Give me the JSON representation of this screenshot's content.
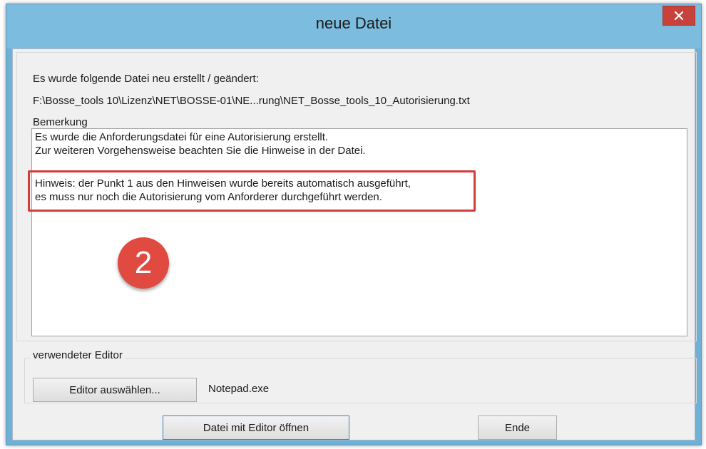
{
  "window": {
    "title": "neue Datei"
  },
  "info": {
    "created_label": "Es wurde folgende Datei neu erstellt / geändert:",
    "file_path": "F:\\Bosse_tools 10\\Lizenz\\NET\\BOSSE-01\\NE...rung\\NET_Bosse_tools_10_Autorisierung.txt",
    "remark_label": "Bemerkung",
    "remark_lines": [
      "Es wurde die Anforderungsdatei für eine Autorisierung erstellt.",
      "Zur weiteren Vorgehensweise beachten Sie die Hinweise in der Datei.",
      "",
      "Hinweis: der Punkt 1 aus den Hinweisen wurde bereits automatisch ausgeführt,",
      "es muss nur noch die Autorisierung vom Anforderer durchgeführt werden."
    ]
  },
  "annotation": {
    "badge_number": "2",
    "highlight_color": "#d63a3a",
    "badge_color": "#e04a40"
  },
  "editor": {
    "group_label": "verwendeter Editor",
    "select_button_label": "Editor auswählen...",
    "current_editor": "Notepad.exe"
  },
  "actions": {
    "open_button_label": "Datei mit Editor öffnen",
    "end_button_label": "Ende"
  },
  "icons": {
    "close": "close-icon"
  },
  "colors": {
    "titlebar": "#7cbcdf",
    "close_button": "#c8423c",
    "dialog_background": "#f0f0f0"
  }
}
